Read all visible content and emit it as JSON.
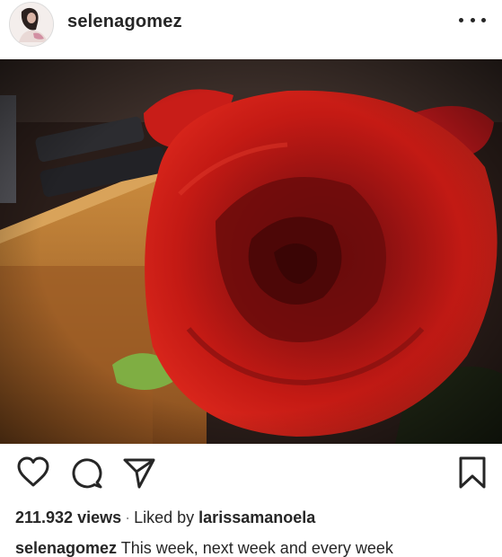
{
  "post": {
    "username": "selenagomez",
    "more_icon": "more-horizontal-icon",
    "media_alt": "red rose",
    "actions": {
      "like_icon": "heart-icon",
      "comment_icon": "comment-bubble-icon",
      "share_icon": "paper-plane-icon",
      "save_icon": "bookmark-icon"
    },
    "views": "211.932 views",
    "separator": "·",
    "liked_by_prefix": "Liked by",
    "liked_by_user": "larissamanoela",
    "caption_user": "selenagomez",
    "caption_text": "This week, next week and every week"
  }
}
